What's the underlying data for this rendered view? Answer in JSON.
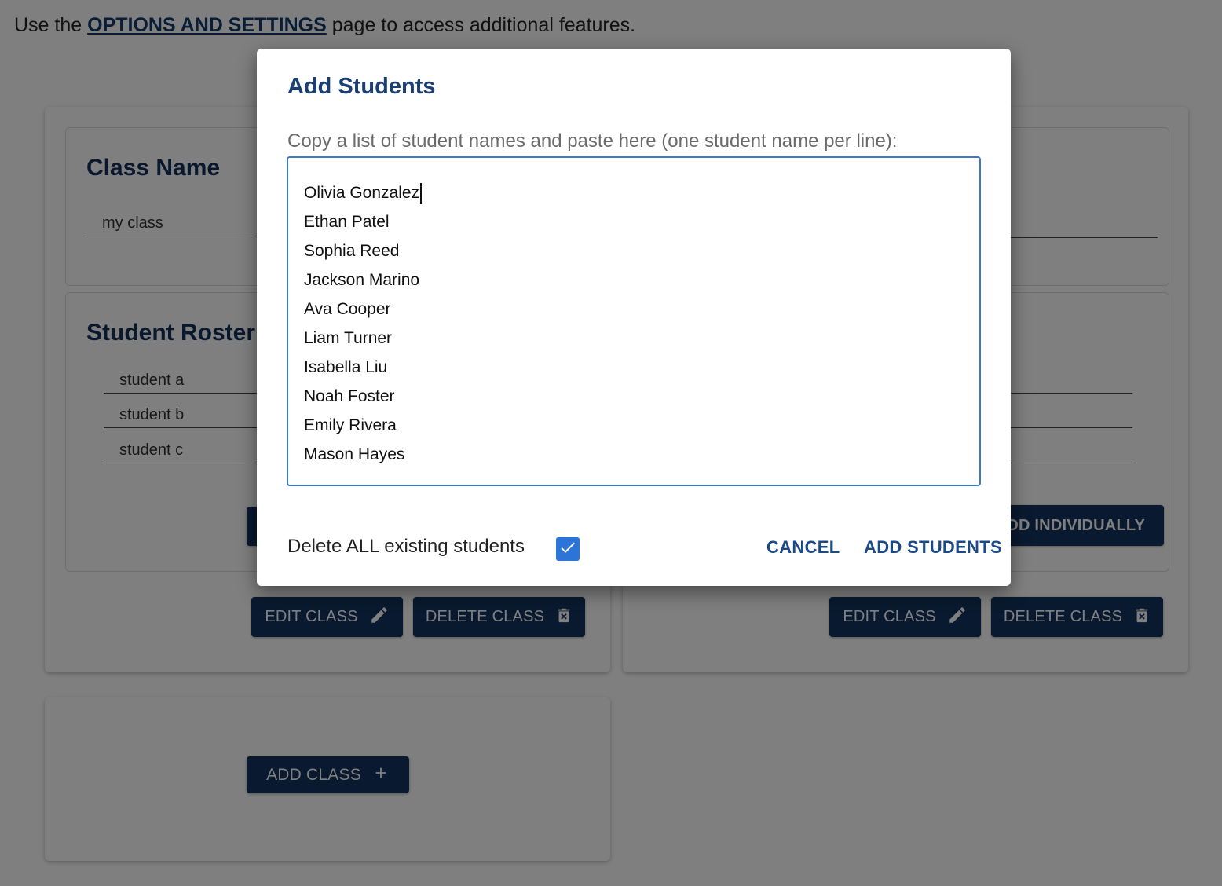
{
  "intro": {
    "prefix": "Use the",
    "link": "OPTIONS AND SETTINGS",
    "suffix": "page to access additional features."
  },
  "class_card": {
    "class_name_title": "Class Name",
    "class_name_value": "my class",
    "roster_title": "Student Roster",
    "students": [
      "student a",
      "student b",
      "student c"
    ],
    "add_individually_label": "ADD INDIVIDUALLY",
    "edit_class_label": "EDIT CLASS",
    "delete_class_label": "DELETE CLASS"
  },
  "add_class": {
    "label": "ADD CLASS"
  },
  "dialog": {
    "title": "Add Students",
    "instruction": "Copy a list of student names and paste here (one student name per line):",
    "names": [
      "Olivia Gonzalez",
      "Ethan Patel",
      "Sophia Reed",
      "Jackson Marino",
      "Ava Cooper",
      "Liam Turner",
      "Isabella Liu",
      "Noah Foster",
      "Emily Rivera",
      "Mason Hayes"
    ],
    "delete_all_label": "Delete ALL existing students",
    "delete_all_checked": true,
    "cancel_label": "CANCEL",
    "submit_label": "ADD STUDENTS"
  },
  "colors": {
    "primary": "#13325f",
    "accent": "#2d74d8",
    "title": "#1b3f73"
  }
}
